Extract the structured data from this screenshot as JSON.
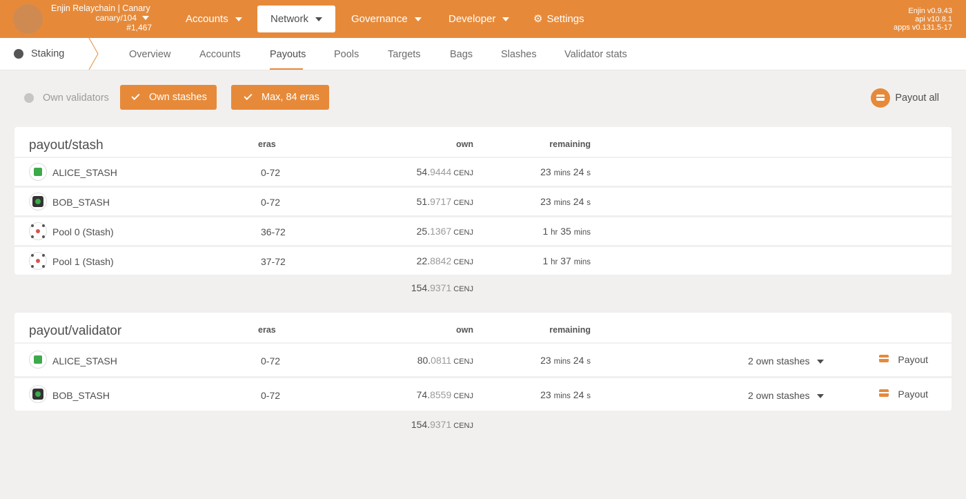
{
  "header": {
    "chain_name": "Enjin Relaychain | Canary",
    "chain_spec": "canary/104",
    "block_number": "#1,467",
    "nav": {
      "accounts": "Accounts",
      "network": "Network",
      "governance": "Governance",
      "developer": "Developer",
      "settings": "Settings"
    },
    "versions": {
      "client": "Enjin v0.9.43",
      "api": "api v10.8.1",
      "apps": "apps v0.131.5-17"
    }
  },
  "subnav": {
    "section": "Staking",
    "tabs": [
      "Overview",
      "Accounts",
      "Payouts",
      "Pools",
      "Targets",
      "Bags",
      "Slashes",
      "Validator stats"
    ],
    "active_tab": "Payouts"
  },
  "toolbar": {
    "own_validators": "Own validators",
    "own_stashes": "Own stashes",
    "max_eras": "Max, 84 eras",
    "payout_all": "Payout all"
  },
  "stash_table": {
    "title": "payout/stash",
    "col_eras": "eras",
    "col_own": "own",
    "col_remaining": "remaining",
    "rows": [
      {
        "name": "ALICE_STASH",
        "eras": "0-72",
        "own_int": "54.",
        "own_dec": "9444",
        "unit": "CENJ",
        "rem_a": "23",
        "rem_a_unit": "mins",
        "rem_b": "24",
        "rem_b_unit": "s"
      },
      {
        "name": "BOB_STASH",
        "eras": "0-72",
        "own_int": "51.",
        "own_dec": "9717",
        "unit": "CENJ",
        "rem_a": "23",
        "rem_a_unit": "mins",
        "rem_b": "24",
        "rem_b_unit": "s"
      },
      {
        "name": "Pool 0 (Stash)",
        "eras": "36-72",
        "own_int": "25.",
        "own_dec": "1367",
        "unit": "CENJ",
        "rem_a": "1",
        "rem_a_unit": "hr",
        "rem_b": "35",
        "rem_b_unit": "mins"
      },
      {
        "name": "Pool 1 (Stash)",
        "eras": "37-72",
        "own_int": "22.",
        "own_dec": "8842",
        "unit": "CENJ",
        "rem_a": "1",
        "rem_a_unit": "hr",
        "rem_b": "37",
        "rem_b_unit": "mins"
      }
    ],
    "total_int": "154.",
    "total_dec": "9371",
    "total_unit": "CENJ"
  },
  "validator_table": {
    "title": "payout/validator",
    "col_eras": "eras",
    "col_own": "own",
    "col_remaining": "remaining",
    "rows": [
      {
        "name": "ALICE_STASH",
        "eras": "0-72",
        "own_int": "80.",
        "own_dec": "0811",
        "unit": "CENJ",
        "rem_a": "23",
        "rem_a_unit": "mins",
        "rem_b": "24",
        "rem_b_unit": "s",
        "stashes": "2 own stashes",
        "payout": "Payout"
      },
      {
        "name": "BOB_STASH",
        "eras": "0-72",
        "own_int": "74.",
        "own_dec": "8559",
        "unit": "CENJ",
        "rem_a": "23",
        "rem_a_unit": "mins",
        "rem_b": "24",
        "rem_b_unit": "s",
        "stashes": "2 own stashes",
        "payout": "Payout"
      }
    ],
    "total_int": "154.",
    "total_dec": "9371",
    "total_unit": "CENJ"
  },
  "colors": {
    "accent": "#e68a3a",
    "background": "#f2f0ef"
  }
}
